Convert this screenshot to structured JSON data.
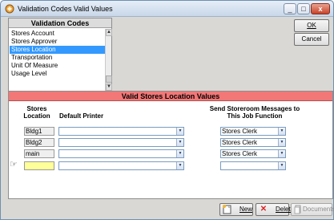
{
  "window": {
    "title": "Validation Codes Valid Values",
    "min_glyph": "_",
    "max_glyph": "□",
    "close_glyph": "x"
  },
  "codes_panel": {
    "header": "Validation Codes",
    "items": [
      {
        "label": "Stores Account"
      },
      {
        "label": "Stores Approver"
      },
      {
        "label": "Stores Location",
        "selected": true
      },
      {
        "label": "Transportation"
      },
      {
        "label": "Unit Of Measure"
      },
      {
        "label": "Usage Level"
      }
    ]
  },
  "buttons": {
    "ok": "OK",
    "cancel": "Cancel",
    "new": "New",
    "delete": "Delete",
    "documents": "Documents"
  },
  "values_panel": {
    "header": "Valid Stores Location Values",
    "col_location": "Stores Location",
    "col_printer": "Default Printer",
    "col_messages": "Send Storeroom Messages to This Job Function",
    "rows": [
      {
        "location": "Bldg1",
        "printer": "",
        "job_function": "Stores Clerk"
      },
      {
        "location": "Bldg2",
        "printer": "",
        "job_function": "Stores Clerk"
      },
      {
        "location": "main",
        "printer": "",
        "job_function": "Stores Clerk"
      },
      {
        "location": "",
        "printer": "",
        "job_function": ""
      }
    ]
  },
  "colors": {
    "values_header_bg": "#f27777",
    "selected_item_bg": "#3399ff",
    "active_cell_bg": "#ffff99"
  }
}
